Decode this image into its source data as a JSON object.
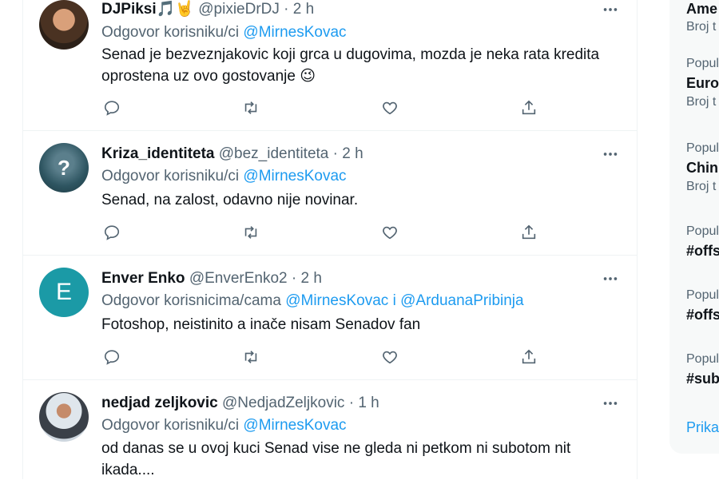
{
  "tweets": [
    {
      "name": "DJPiksi🎵🤘",
      "handle": "@pixieDrDJ",
      "separator": "·",
      "time": "2 h",
      "reply_prefix": "Odgovor korisniku/ci",
      "reply_mentions": [
        "@MirnesKovac"
      ],
      "text_lines": [
        "Senad je bezveznjakovic koji grca u dugovima, mozda je neka rata kredita",
        "oprostena uz ovo gostovanje 😉"
      ],
      "avatar": {
        "type": "photo",
        "color": "#6b4a30"
      }
    },
    {
      "name": "Kriza_identiteta",
      "handle": "@bez_identiteta",
      "separator": "·",
      "time": "2 h",
      "reply_prefix": "Odgovor korisniku/ci",
      "reply_mentions": [
        "@MirnesKovac"
      ],
      "text_lines": [
        "Senad, na zalost, odavno nije novinar."
      ],
      "avatar": {
        "type": "question",
        "color": "#2e5561"
      }
    },
    {
      "name": "Enver Enko",
      "handle": "@EnverEnko2",
      "separator": "·",
      "time": "2 h",
      "reply_prefix": "Odgovor korisnicima/cama",
      "reply_mentions": [
        "@MirnesKovac",
        "i",
        "@ArduanaPribinja"
      ],
      "text_lines": [
        "Fotoshop, neistinito a inače nisam Senadov fan"
      ],
      "avatar": {
        "type": "letter",
        "letter": "E",
        "color": "#1b9aa6"
      }
    },
    {
      "name": "nedjad zeljkovic",
      "handle": "@NedjadZeljkovic",
      "separator": "·",
      "time": "1 h",
      "reply_prefix": "Odgovor korisniku/ci",
      "reply_mentions": [
        "@MirnesKovac"
      ],
      "text_lines": [
        "od danas se u ovoj kuci Senad vise ne gleda ni petkom ni subotom nit",
        "ikada...."
      ],
      "avatar": {
        "type": "photo",
        "color": "#c9d3dc"
      }
    }
  ],
  "sidebar": {
    "trends": [
      {
        "context": "",
        "title": "Ame",
        "count": "Broj t"
      },
      {
        "context": "Popul",
        "title": "Euro",
        "count": "Broj t"
      },
      {
        "context": "Popul",
        "title": "Chin",
        "count": "Broj t"
      },
      {
        "context": "Popul",
        "title": "#offs",
        "count": ""
      },
      {
        "context": "Popul",
        "title": "#offs",
        "count": ""
      },
      {
        "context": "Popul",
        "title": "#sub",
        "count": ""
      }
    ],
    "show_more": "Prika"
  },
  "colors": {
    "accent": "#1d9bf0",
    "secondary_text": "#536471",
    "border": "#eff3f4"
  },
  "icons": [
    "reply-icon",
    "retweet-icon",
    "like-icon",
    "share-icon",
    "more-icon"
  ]
}
